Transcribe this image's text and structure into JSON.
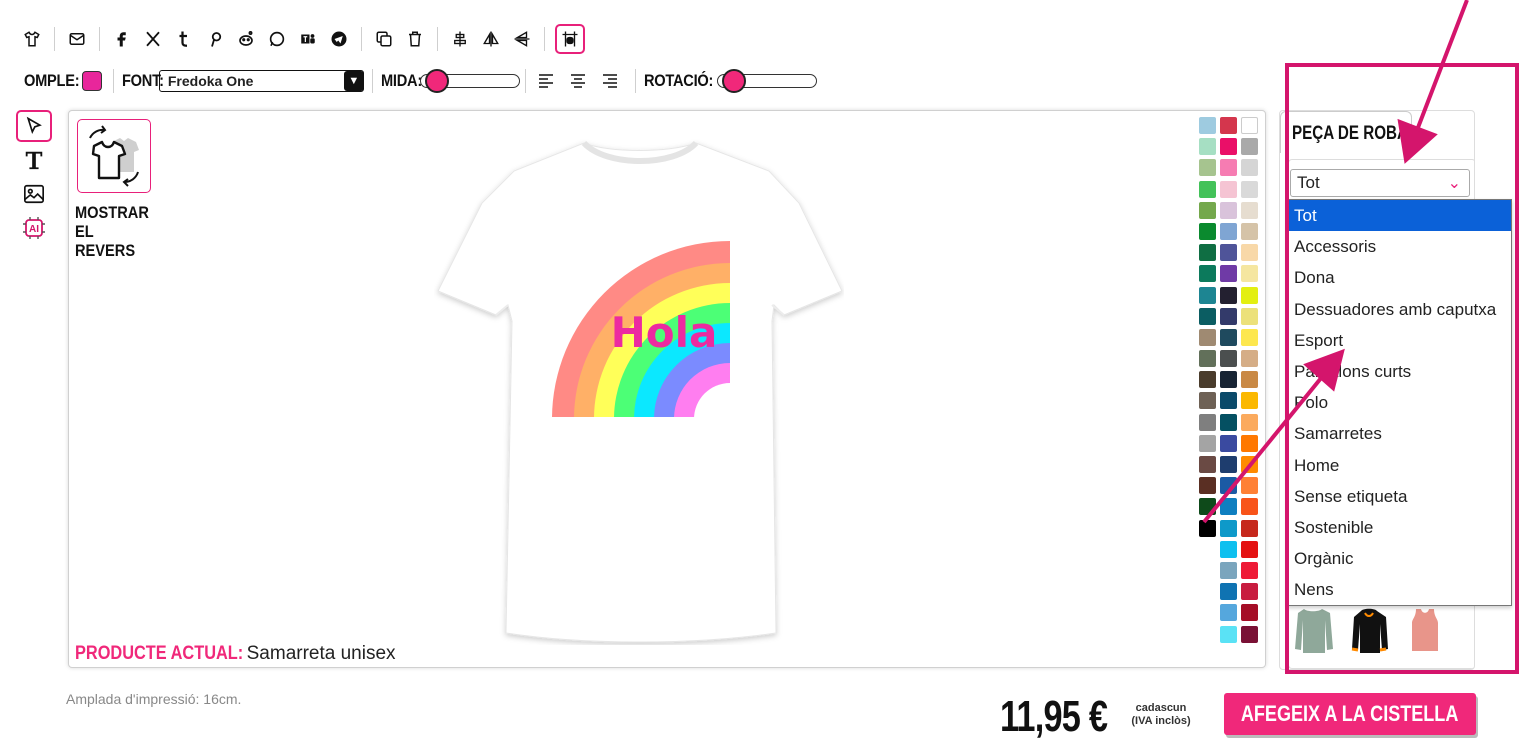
{
  "toolbar": {
    "icons": [
      "tshirt-icon",
      "mail-icon",
      "facebook-icon",
      "x-icon",
      "tumblr-icon",
      "pinterest-icon",
      "reddit-icon",
      "whatsapp-icon",
      "teams-icon",
      "telegram-icon",
      "duplicate-icon",
      "trash-icon",
      "align-center-icon",
      "flip-horizontal-icon",
      "flip-vertical-icon",
      "center-grid-icon"
    ]
  },
  "text_toolbar": {
    "fill_label": "OMPLE:",
    "fill_color": "#e8269b",
    "font_label": "FONT:",
    "font_value": "Fredoka One",
    "size_label": "MIDA:",
    "rotation_label": "ROTACIÓ:",
    "accent": "#f0287a"
  },
  "tools": [
    "pointer-icon",
    "text-icon",
    "image-icon",
    "ai-icon"
  ],
  "canvas": {
    "flip_label": "MOSTRAR EL REVERS",
    "design_text": "Hola",
    "current_label": "PRODUCTE ACTUAL:",
    "current_value": "Samarreta unisex"
  },
  "palette": [
    [
      "#9ecbe0",
      "#d4364d",
      "#ffffff"
    ],
    [
      "#a6dfc3",
      "#ea0f68",
      "#a9a9a9"
    ],
    [
      "#a6c48f",
      "#f67cb2",
      "#d5d5d5"
    ],
    [
      "#43c259",
      "#f5c4d3",
      "#d9d9d9"
    ],
    [
      "#74a84c",
      "#d9c3db",
      "#e6ddd0"
    ],
    [
      "#0a8a2e",
      "#7fa5d3",
      "#d5c3a8"
    ],
    [
      "#0f6e43",
      "#4f5499",
      "#f8d8a8"
    ],
    [
      "#0c7a5c",
      "#6f3aa6",
      "#f5e6a0"
    ],
    [
      "#1d8592",
      "#232030",
      "#e3ef10"
    ],
    [
      "#0b5d62",
      "#333a6a",
      "#ece17a"
    ],
    [
      "#9f8a72",
      "#1f4a5e",
      "#fde74e"
    ],
    [
      "#62705a",
      "#4b4f4f",
      "#d5ad86"
    ],
    [
      "#4a3c2c",
      "#172434",
      "#c98945"
    ],
    [
      "#6e6155",
      "#0a4a6a",
      "#fbb800"
    ],
    [
      "#7f7f7f",
      "#045062",
      "#fbaa5d"
    ],
    [
      "#a4a4a4",
      "#3a4aa0",
      "#ff7800"
    ],
    [
      "#6a4a44",
      "#1e3d6e",
      "#ff8a00"
    ],
    [
      "#5a2f23",
      "#1b5aa4",
      "#ff8035"
    ],
    [
      "#0e4a1a",
      "#0f7fc0",
      "#f8541a"
    ],
    [
      "#000000",
      "#0e99c9",
      "#c6281c"
    ],
    [
      "",
      "#0ec0ef",
      "#e41212"
    ],
    [
      "",
      "#7aa5bd",
      "#ee1a36"
    ],
    [
      "",
      "#0f73b2",
      "#c81c3f"
    ],
    [
      "",
      "#55a7dd",
      "#a50d26"
    ],
    [
      "",
      "#5ae2f5",
      "#7a1135"
    ]
  ],
  "right_panel": {
    "title": "PEÇA DE ROBA",
    "select_value": "Tot",
    "options": [
      "Tot",
      "Accessoris",
      "Dona",
      "Dessuadores amb caputxa",
      "Esport",
      "Pantalons curts",
      "Polo",
      "Samarretes",
      "Home",
      "Sense etiqueta",
      "Sostenible",
      "Orgànic",
      "Nens"
    ],
    "selected_option": "Tot"
  },
  "annotation_color": "#d4156c",
  "footer": {
    "print_width": "Amplada d'impressió: 16cm.",
    "price": "11,95 €",
    "price_note_line1": "cadascun",
    "price_note_line2": "(IVA inclòs)",
    "add_to_cart": "AFEGEIX A LA CISTELLA"
  }
}
